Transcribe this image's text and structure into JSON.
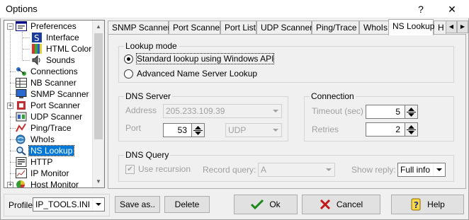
{
  "window": {
    "title": "Options",
    "help_glyph": "?",
    "close_glyph": "✕"
  },
  "tree": {
    "items": [
      {
        "label": "Preferences",
        "icon": "preferences-icon",
        "level": 0,
        "expander": "−"
      },
      {
        "label": "Interface",
        "icon": "interface-icon",
        "level": 1
      },
      {
        "label": "HTML Colors",
        "icon": "palette-icon",
        "level": 1
      },
      {
        "label": "Sounds",
        "icon": "speaker-icon",
        "level": 1
      },
      {
        "label": "Connections",
        "icon": "connections-icon",
        "level": 0
      },
      {
        "label": "NB Scanner",
        "icon": "grid-icon",
        "level": 0
      },
      {
        "label": "SNMP Scanner",
        "icon": "monitor-icon",
        "level": 0
      },
      {
        "label": "Port Scanner",
        "icon": "port-icon",
        "level": 0,
        "expander": "+"
      },
      {
        "label": "UDP Scanner",
        "icon": "udp-icon",
        "level": 0
      },
      {
        "label": "Ping/Trace",
        "icon": "ping-icon",
        "level": 0
      },
      {
        "label": "WhoIs",
        "icon": "whois-icon",
        "level": 0
      },
      {
        "label": "NS Lookup",
        "icon": "nslookup-icon",
        "level": 0,
        "selected": true
      },
      {
        "label": "HTTP",
        "icon": "http-icon",
        "level": 0
      },
      {
        "label": "IP Monitor",
        "icon": "ipmonitor-icon",
        "level": 0
      },
      {
        "label": "Host Monitor",
        "icon": "hostmonitor-icon",
        "level": 0,
        "expander": "+"
      }
    ]
  },
  "tabs": [
    {
      "label": "SNMP Scanner"
    },
    {
      "label": "Port Scanner"
    },
    {
      "label": "Port List"
    },
    {
      "label": "UDP Scanner"
    },
    {
      "label": "Ping/Trace"
    },
    {
      "label": "WhoIs"
    },
    {
      "label": "NS Lookup",
      "active": true
    },
    {
      "label": "H"
    }
  ],
  "lookup_mode": {
    "title": "Lookup mode",
    "options": [
      {
        "label": "Standard lookup using Windows API",
        "selected": true
      },
      {
        "label": "Advanced Name Server Lookup",
        "selected": false
      }
    ]
  },
  "dns_server": {
    "title": "DNS Server",
    "address_label": "Address",
    "address_value": "205.233.109.39",
    "port_label": "Port",
    "port_value": "53",
    "protocol_value": "UDP"
  },
  "connection": {
    "title": "Connection",
    "timeout_label": "Timeout (sec)",
    "timeout_value": "5",
    "retries_label": "Retries",
    "retries_value": "2"
  },
  "dns_query": {
    "title": "DNS Query",
    "use_recursion_label": "Use recursion",
    "use_recursion_checked": true,
    "record_query_label": "Record query:",
    "record_query_value": "A",
    "show_reply_label": "Show reply:",
    "show_reply_value": "Full info"
  },
  "bottom": {
    "profile_label": "Profile",
    "profile_value": "IP_TOOLS.INI",
    "save_as_label": "Save as..",
    "delete_label": "Delete",
    "ok_label": "Ok",
    "cancel_label": "Cancel",
    "help_label": "Help"
  },
  "colors": {
    "selection": "#0078d7",
    "ok_check": "#1a8a1a",
    "cancel_x": "#c01818"
  }
}
